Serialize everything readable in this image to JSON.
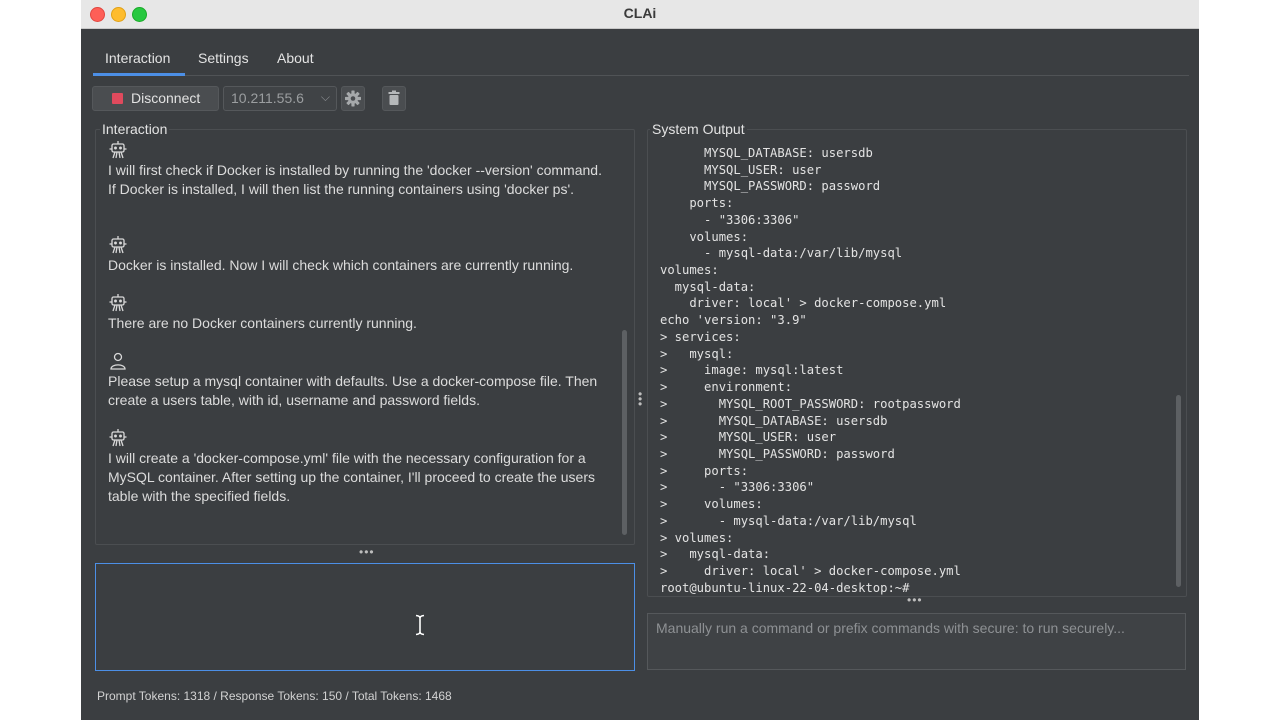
{
  "window": {
    "title": "CLAi"
  },
  "tabs": [
    {
      "label": "Interaction",
      "active": true
    },
    {
      "label": "Settings",
      "active": false
    },
    {
      "label": "About",
      "active": false
    }
  ],
  "toolbar": {
    "disconnect_label": "Disconnect",
    "disconnect_icon": "stop-icon",
    "ip_value": "10.211.55.6",
    "settings_icon": "gear-icon",
    "clear_icon": "trash-icon"
  },
  "interaction": {
    "label": "Interaction",
    "messages": [
      {
        "role": "assistant",
        "icon": "robot-icon",
        "text": "I will first check if Docker is installed by running the 'docker --version' command. If Docker is installed, I will then list the running containers using 'docker ps'."
      },
      {
        "role": "assistant",
        "icon": "robot-icon",
        "text": "Docker is installed. Now I will check which containers are currently running."
      },
      {
        "role": "assistant",
        "icon": "robot-icon",
        "text": "There are no Docker containers currently running."
      },
      {
        "role": "user",
        "icon": "user-icon",
        "text": "Please setup a mysql container with defaults. Use a docker-compose file. Then create a users table, with id, username and password fields."
      },
      {
        "role": "assistant",
        "icon": "robot-icon",
        "text": "I will create a 'docker-compose.yml' file with the necessary configuration for a MySQL container. After setting up the container, I'll proceed to create the users table with the specified fields."
      }
    ],
    "prompt_value": ""
  },
  "tokens": "Prompt Tokens: 1318 / Response Tokens: 150 / Total Tokens: 1468",
  "system_output": {
    "label": "System Output",
    "lines": [
      "      MYSQL_DATABASE: usersdb",
      "      MYSQL_USER: user",
      "      MYSQL_PASSWORD: password",
      "    ports:",
      "      - \"3306:3306\"",
      "    volumes:",
      "      - mysql-data:/var/lib/mysql",
      "volumes:",
      "  mysql-data:",
      "    driver: local' > docker-compose.yml",
      "echo 'version: \"3.9\"",
      "> services:",
      ">   mysql:",
      ">     image: mysql:latest",
      ">     environment:",
      ">       MYSQL_ROOT_PASSWORD: rootpassword",
      ">       MYSQL_DATABASE: usersdb",
      ">       MYSQL_USER: user",
      ">       MYSQL_PASSWORD: password",
      ">     ports:",
      ">       - \"3306:3306\"",
      ">     volumes:",
      ">       - mysql-data:/var/lib/mysql",
      "> volumes:",
      ">   mysql-data:",
      ">     driver: local' > docker-compose.yml",
      "root@ubuntu-linux-22-04-desktop:~#"
    ],
    "command_placeholder": "Manually run a command or prefix commands with secure: to run securely..."
  },
  "colors": {
    "accent": "#4c8fe6",
    "stop": "#e04a5d",
    "background": "#3b3e41"
  }
}
